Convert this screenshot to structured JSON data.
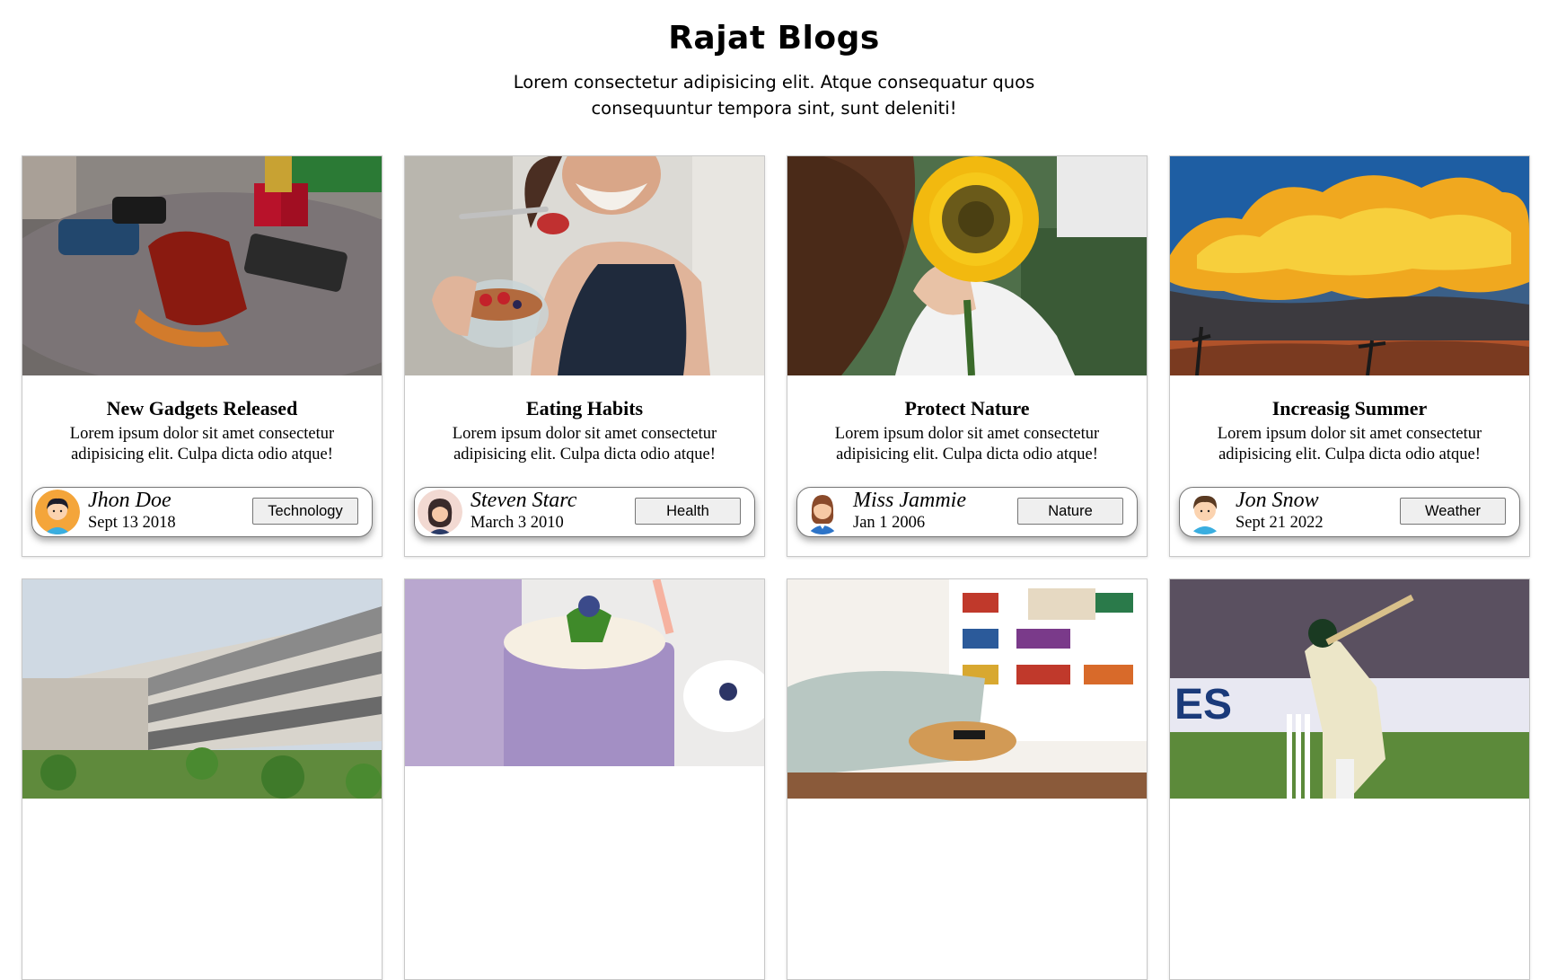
{
  "header": {
    "title": "Rajat Blogs",
    "subtitle": "Lorem consectetur adipisicing elit. Atque consequatur quos consequuntur tempora sint, sunt deleniti!"
  },
  "cards": [
    {
      "title": "New Gadgets Released",
      "text": "Lorem ipsum dolor sit amet consectetur adipisicing elit. Culpa dicta odio atque!",
      "author": "Jhon Doe",
      "date": "Sept 13 2018",
      "tag": "Technology"
    },
    {
      "title": "Eating Habits",
      "text": "Lorem ipsum dolor sit amet consectetur adipisicing elit. Culpa dicta odio atque!",
      "author": "Steven Starc",
      "date": "March 3 2010",
      "tag": "Health"
    },
    {
      "title": "Protect Nature",
      "text": "Lorem ipsum dolor sit amet consectetur adipisicing elit. Culpa dicta odio atque!",
      "author": "Miss Jammie",
      "date": "Jan 1 2006",
      "tag": "Nature"
    },
    {
      "title": "Increasig Summer",
      "text": "Lorem ipsum dolor sit amet consectetur adipisicing elit. Culpa dicta odio atque!",
      "author": "Jon Snow",
      "date": "Sept 21 2022",
      "tag": "Weather"
    }
  ],
  "thumbnails": [
    "gadgets-photo",
    "healthy-bowl-photo",
    "sunflower-photo",
    "storm-clouds-photo",
    "college-building-photo",
    "blueberry-smoothie-photo",
    "living-room-photo",
    "cricket-batsman-photo"
  ],
  "colors": {
    "card_border": "#c8c8c8",
    "button_bg": "#efefef"
  }
}
